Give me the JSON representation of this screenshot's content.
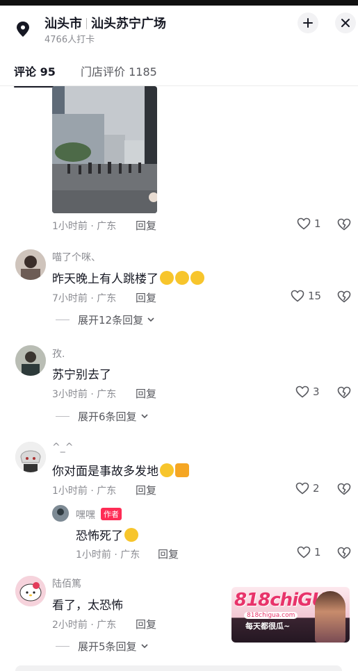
{
  "header": {
    "city": "汕头市",
    "place": "汕头苏宁广场",
    "checkins": "4766人打卡"
  },
  "tabs": [
    {
      "label": "评论 95",
      "active": true
    },
    {
      "label": "门店评价 1185",
      "active": false
    }
  ],
  "comments": [
    {
      "id": "c0",
      "meta": "1小时前 · 广东",
      "reply_label": "回复",
      "likes": "1",
      "has_photo": true
    },
    {
      "id": "c1",
      "user": "喵了个咪、",
      "text": "昨天晚上有人跳楼了",
      "emoji_count": 3,
      "meta": "7小时前 · 广东",
      "reply_label": "回复",
      "likes": "15",
      "expand": "展开12条回复"
    },
    {
      "id": "c2",
      "user": "孜.",
      "text": "苏宁别去了",
      "meta": "3小时前 · 广东",
      "reply_label": "回复",
      "likes": "3",
      "expand": "展开6条回复"
    },
    {
      "id": "c3",
      "user": "^_^",
      "text": "你对面是事故多发地",
      "meta": "1小时前 · 广东",
      "reply_label": "回复",
      "likes": "2",
      "reply": {
        "user": "嘿嘿",
        "tag": "作者",
        "text": "恐怖死了",
        "meta": "1小时前 · 广东",
        "reply_label": "回复",
        "likes": "1"
      }
    },
    {
      "id": "c4",
      "user": "陆佰篤",
      "text": "看了，太恐怖",
      "meta": "2小时前 · 广东",
      "reply_label": "回复",
      "expand": "展开5条回复"
    }
  ],
  "ad": {
    "logo": "818chiGUA",
    "url": "818chigua.com",
    "slogan": "每天都很瓜~"
  },
  "icons": {
    "location": "location-pin-icon",
    "share": "share-icon",
    "close": "close-icon",
    "like": "heart-outline-icon",
    "dislike": "broken-heart-icon",
    "chevron": "chevron-down-icon"
  },
  "colors": {
    "primary_text": "#161823",
    "secondary_text": "#8a8b91",
    "author_tag": "#fe2c55"
  }
}
